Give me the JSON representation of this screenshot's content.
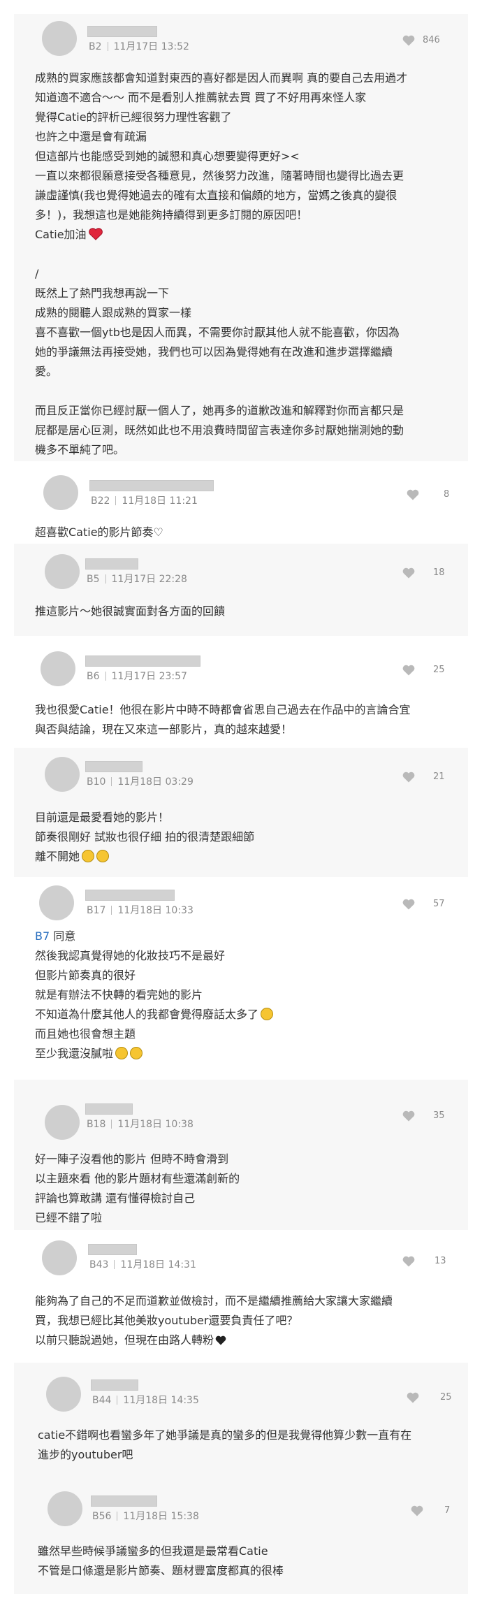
{
  "heart_color": "#b9b9b9",
  "comments": [
    {
      "floor": "B2",
      "date": "11月17日 13:52",
      "likes": "846",
      "lines": [
        "成熟的買家應該都會知道對東西的喜好都是因人而異啊 真的要自己去用過才",
        "知道適不適合～～ 而不是看別人推薦就去買 買了不好用再來怪人家",
        "覺得Catie的評析已經很努力理性客觀了",
        "也許之中還是會有疏漏",
        "但這部片也能感受到她的誠懇和真心想要變得更好><",
        "一直以來都很願意接受各種意見，然後努力改進，隨著時間也變得比過去更",
        "謙虛謹慎(我也覺得她過去的確有太直接和偏頗的地方，當媽之後真的變很",
        "多！)，我想這也是她能夠持續得到更多訂閱的原因吧！",
        "Catie加油",
        "",
        "/",
        "既然上了熱門我想再說一下",
        "成熟的閱聽人跟成熟的買家一樣",
        "喜不喜歡一個ytb也是因人而異，不需要你討厭其他人就不能喜歡，你因為",
        "她的爭議無法再接受她，我們也可以因為覺得她有在改進和進步選擇繼續",
        "愛。",
        "",
        "而且反正當你已經討厭一個人了，她再多的道歉改進和解釋對你而言都只是",
        "屁都是居心叵測，既然如此也不用浪費時間留言表達你多討厭她揣測她的動",
        "機多不單純了吧。"
      ]
    },
    {
      "floor": "B22",
      "date": "11月18日 11:21",
      "likes": "8",
      "lines": [
        "超喜歡Catie的影片節奏♡"
      ]
    },
    {
      "floor": "B5",
      "date": "11月17日 22:28",
      "likes": "18",
      "lines": [
        "推這影片～她很誠實面對各方面的回饋"
      ]
    },
    {
      "floor": "B6",
      "date": "11月17日 23:57",
      "likes": "25",
      "lines": [
        "我也很愛Catie！他很在影片中時不時都會省思自己過去在作品中的言論合宜",
        "與否與結論，現在又來這一部影片，真的越來越愛！"
      ]
    },
    {
      "floor": "B10",
      "date": "11月18日 03:29",
      "likes": "21",
      "lines": [
        "目前還是最愛看她的影片！",
        "節奏很剛好 試妝也很仔細 拍的很清楚跟細節",
        "離不開她"
      ]
    },
    {
      "floor": "B17",
      "date": "11月18日 10:33",
      "likes": "57",
      "reply_tag": "B7",
      "reply_text": " 同意",
      "lines": [
        "然後我認真覺得她的化妝技巧不是最好",
        "但影片節奏真的很好",
        "就是有辦法不快轉的看完她的影片",
        "不知道為什麼其他人的我都會覺得廢話太多了",
        "而且她也很會想主題",
        "至少我還沒膩啦"
      ]
    },
    {
      "floor": "B18",
      "date": "11月18日 10:38",
      "likes": "35",
      "lines": [
        "好一陣子沒看他的影片 但時不時會滑到",
        "以主題來看 他的影片題材有些還滿創新的",
        "評論也算敢講 還有懂得檢討自己",
        "已經不錯了啦"
      ]
    },
    {
      "floor": "B43",
      "date": "11月18日 14:31",
      "likes": "13",
      "lines": [
        "能夠為了自己的不足而道歉並做檢討，而不是繼續推薦給大家讓大家繼續",
        "買，我想已經比其他美妝youtuber還要負責任了吧？",
        "以前只聽說過她，但現在由路人轉粉"
      ]
    },
    {
      "floor": "B44",
      "date": "11月18日 14:35",
      "likes": "25",
      "lines": [
        "catie不錯啊也看蠻多年了她爭議是真的蠻多的但是我覺得他算少數一直有在",
        "進步的youtuber吧"
      ]
    },
    {
      "floor": "B56",
      "date": "11月18日 15:38",
      "likes": "7",
      "lines": [
        "雖然早些時候爭議蠻多的但我還是最常看Catie",
        "不管是口條還是影片節奏、題材豐富度都真的很棒"
      ]
    }
  ]
}
